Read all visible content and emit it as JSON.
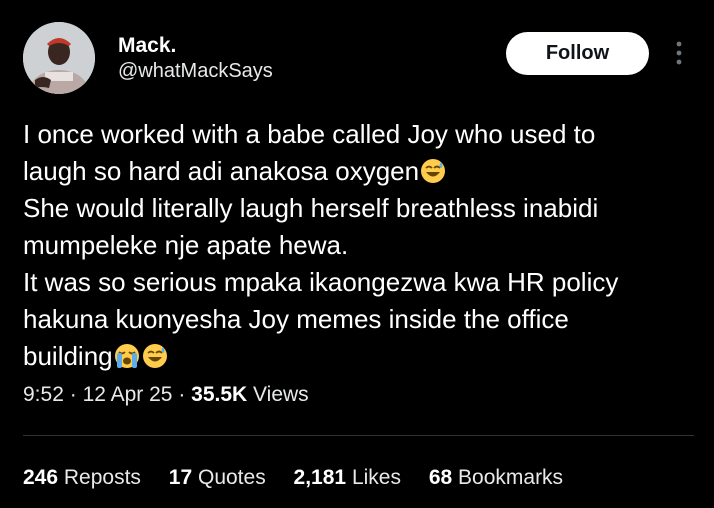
{
  "author": {
    "name": "Mack.",
    "handle": "@whatMackSays"
  },
  "follow_label": "Follow",
  "tweet": {
    "lines": [
      "I once worked with a babe called Joy who used to",
      "laugh so hard adi anakosa oxygen",
      "She would literally laugh herself breathless inabidi",
      "mumpeleke nje apate hewa.",
      "It was so serious mpaka ikaongezwa kwa HR policy",
      "hakuna kuonyesha Joy memes inside the office",
      "building"
    ]
  },
  "meta": {
    "time": "9:52",
    "date": "12 Apr 25",
    "views_count": "35.5K",
    "views_label": "Views",
    "separator": "·"
  },
  "stats": {
    "reposts": {
      "count": "246",
      "label": "Reposts"
    },
    "quotes": {
      "count": "17",
      "label": "Quotes"
    },
    "likes": {
      "count": "2,181",
      "label": "Likes"
    },
    "bookmarks": {
      "count": "68",
      "label": "Bookmarks"
    }
  },
  "icons": {
    "more": "more-vertical-icon",
    "laugh": "grinning-sweat-emoji",
    "cry": "loudly-crying-emoji"
  },
  "colors": {
    "background": "#000000",
    "text": "#e7e9ea",
    "button_bg": "#ffffff",
    "divider": "#2f3336"
  }
}
